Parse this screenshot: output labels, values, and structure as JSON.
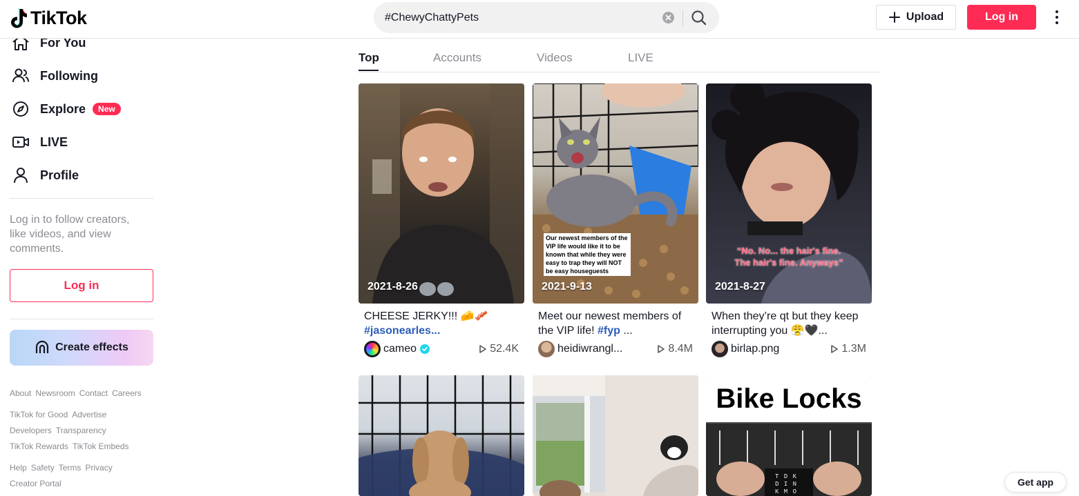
{
  "app": {
    "logo_text": "TikTok"
  },
  "search": {
    "value": "#ChewyChattyPets"
  },
  "header": {
    "upload_label": "Upload",
    "login_label": "Log in"
  },
  "sidebar": {
    "nav": [
      {
        "label": "For You",
        "icon": "home-icon"
      },
      {
        "label": "Following",
        "icon": "users-icon"
      },
      {
        "label": "Explore",
        "icon": "compass-icon",
        "badge": "New"
      },
      {
        "label": "LIVE",
        "icon": "live-camera-icon"
      },
      {
        "label": "Profile",
        "icon": "person-icon"
      }
    ],
    "login_message": "Log in to follow creators, like videos, and view comments.",
    "login_label": "Log in",
    "effects_label": "Create effects",
    "footer_groups": [
      [
        "About",
        "Newsroom",
        "Contact",
        "Careers"
      ],
      [
        "TikTok for Good",
        "Advertise",
        "Developers",
        "Transparency",
        "TikTok Rewards",
        "TikTok Embeds"
      ],
      [
        "Help",
        "Safety",
        "Terms",
        "Privacy",
        "Creator Portal"
      ]
    ]
  },
  "tabs": [
    "Top",
    "Accounts",
    "Videos",
    "LIVE"
  ],
  "videos": [
    {
      "date": "2021-8-26",
      "desc": "CHEESE JERKY!!! 🧀🥓",
      "tag": "#jasonearles...",
      "author": "cameo",
      "verified": true,
      "views": "52.4K"
    },
    {
      "date": "2021-9-13",
      "desc": "Meet our newest members of the VIP life!",
      "tag": "#fyp",
      "tag_suffix": " ...",
      "author": "heidiwrangl...",
      "views": "8.4M",
      "caption": "Our newest members of the VIP life would like it to be known that while they were easy to trap they will NOT be easy houseguests"
    },
    {
      "date": "2021-8-27",
      "desc": "When they’re qt but they keep interrupting you 😤🖤...",
      "author": "birlap.png",
      "views": "1.3M",
      "caption_line1": "“No. No... the hair's fine.",
      "caption_line2": "The hair's fine. Anyways”"
    },
    {
      "label": ""
    },
    {
      "label": ""
    },
    {
      "label": "Bike Locks",
      "lock_letters": "T D K D I N K M O S M"
    }
  ],
  "get_app_label": "Get app",
  "colors": {
    "brand": "#fe2c55",
    "hashtag": "#2b5db9",
    "muted": "#8a8b91"
  }
}
